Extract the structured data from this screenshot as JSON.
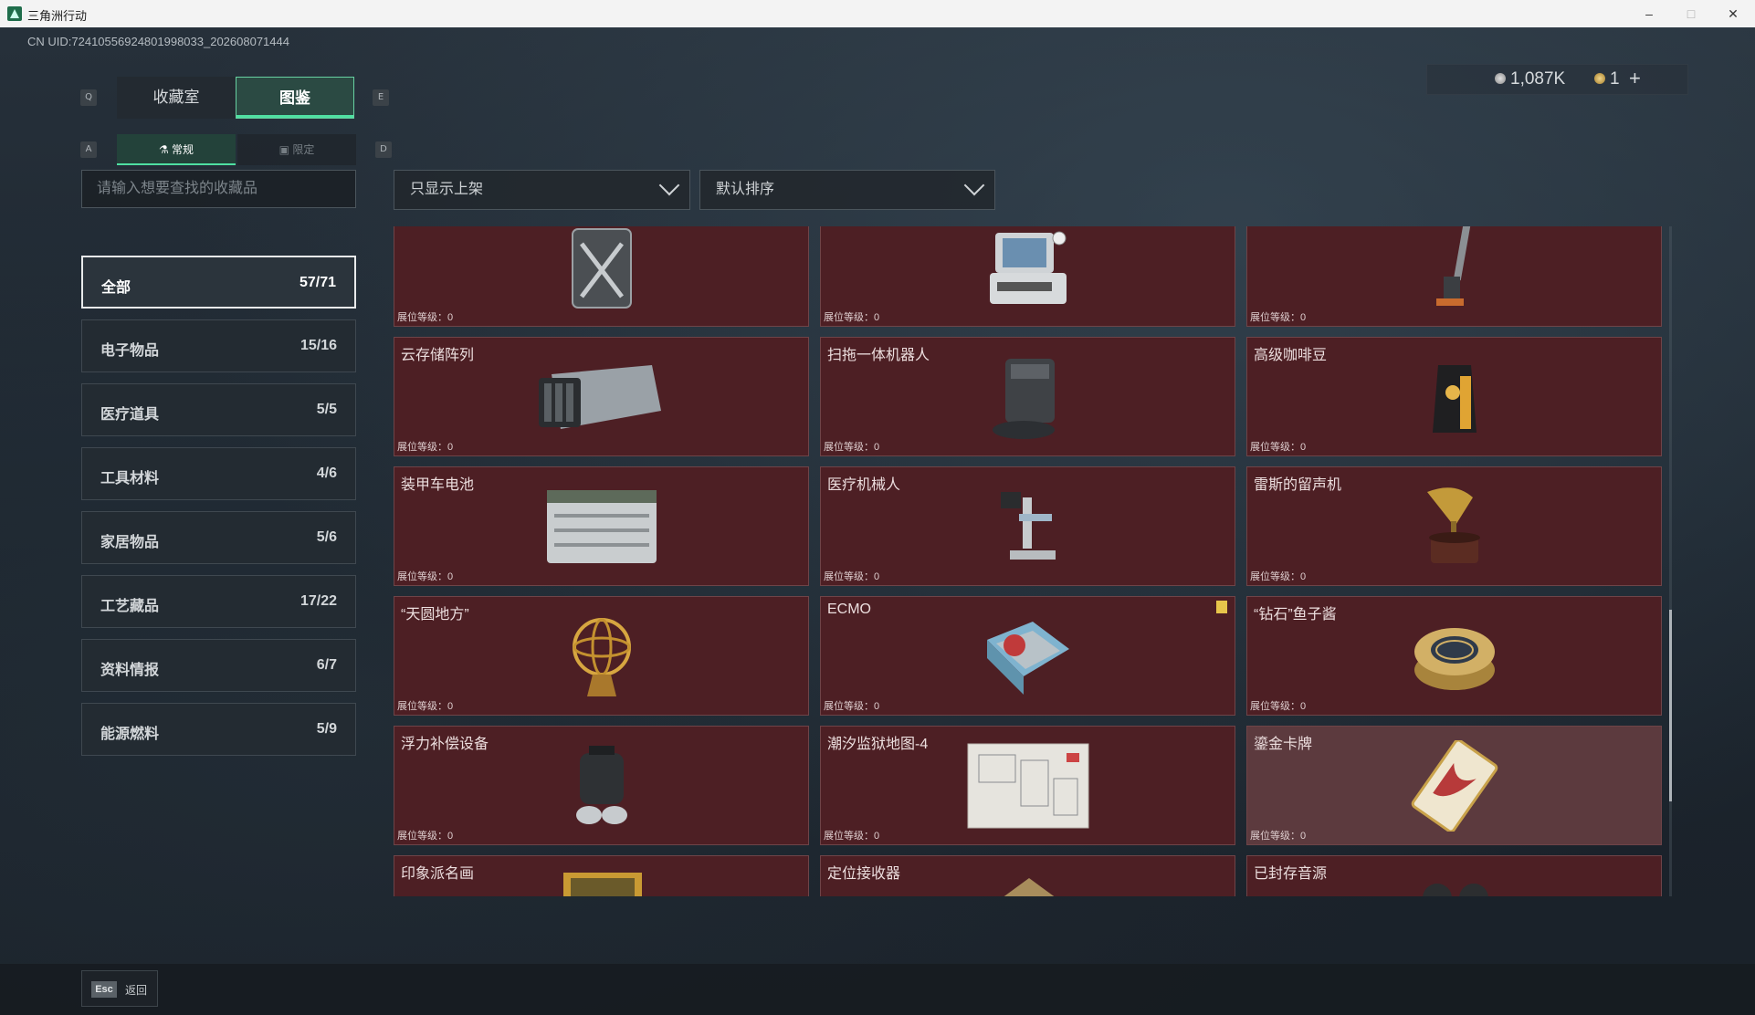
{
  "window": {
    "title": "三角洲行动",
    "minimize": "–",
    "maximize": "□",
    "close": "✕"
  },
  "uid": "CN UID:7241055692480199803​3_202608071444",
  "currency": {
    "coins": "1,087K",
    "tokens": "1",
    "add": "+"
  },
  "key_hints": {
    "prev_tab": "Q",
    "next_tab": "E",
    "prev_sub": "A",
    "next_sub": "D"
  },
  "tabs": [
    {
      "label": "收藏室"
    },
    {
      "label": "图鉴"
    }
  ],
  "subtabs": [
    {
      "label": "常规"
    },
    {
      "label": "限定"
    }
  ],
  "search": {
    "placeholder": "请输入想要查找的收藏品"
  },
  "filters": {
    "shelf": "只显示上架",
    "sort": "默认排序"
  },
  "categories": [
    {
      "name": "全部",
      "count": "57/71"
    },
    {
      "name": "电子物品",
      "count": "15/16"
    },
    {
      "name": "医疗道具",
      "count": "5/5"
    },
    {
      "name": "工具材料",
      "count": "4/6"
    },
    {
      "name": "家居物品",
      "count": "5/6"
    },
    {
      "name": "工艺藏品",
      "count": "17/22"
    },
    {
      "name": "资料情报",
      "count": "6/7"
    },
    {
      "name": "能源燃料",
      "count": "5/9"
    }
  ],
  "level_label": "展位等级：0",
  "items": [
    {
      "name": "",
      "icon": "fuel-can"
    },
    {
      "name": "",
      "icon": "computer-terminal"
    },
    {
      "name": "",
      "icon": "floor-scrubber"
    },
    {
      "name": "云存储阵列",
      "icon": "server-array"
    },
    {
      "name": "扫拖一体机器人",
      "icon": "robot-mop"
    },
    {
      "name": "高级咖啡豆",
      "icon": "coffee-bag"
    },
    {
      "name": "装甲车电池",
      "icon": "vehicle-battery"
    },
    {
      "name": "医疗机械人",
      "icon": "medical-robot"
    },
    {
      "name": "雷斯的留声机",
      "icon": "gramophone"
    },
    {
      "name": "“天圆地方”",
      "icon": "armillary-sphere"
    },
    {
      "name": "ECMO",
      "icon": "ecmo-machine"
    },
    {
      "name": "“钻石”鱼子酱",
      "icon": "caviar-tin"
    },
    {
      "name": "浮力补偿设备",
      "icon": "buoyancy-device"
    },
    {
      "name": "潮汐监狱地图-4",
      "icon": "prison-map"
    },
    {
      "name": "鎏金卡牌",
      "icon": "gilded-card"
    },
    {
      "name": "印象派名画",
      "icon": "painting"
    },
    {
      "name": "定位接收器",
      "icon": "locator"
    },
    {
      "name": "已封存音源",
      "icon": "sealed-audio"
    }
  ],
  "footer": {
    "esc_key": "Esc",
    "back": "返回"
  },
  "colors": {
    "accent": "#4fe0a2",
    "card_bg": "#4d1f24",
    "highlight_card": "#5c3a3e",
    "badge": "#e7c54b"
  }
}
